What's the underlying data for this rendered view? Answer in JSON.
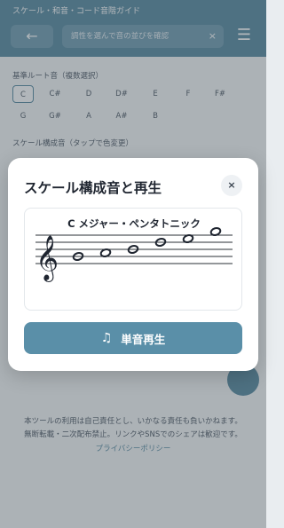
{
  "background": {
    "top_text": "スケール・和音・コード音階ガイド",
    "back_label": "←",
    "search_text": "調性を選んで音の並びを確認",
    "search_clear": "×",
    "menu_icon": "menu-icon",
    "root_label": "基準ルート音（複数選択）",
    "notes_row1": [
      "C",
      "C#",
      "D",
      "D#",
      "E",
      "F",
      "F#"
    ],
    "notes_row2": [
      "G",
      "G#",
      "A",
      "A#",
      "B"
    ],
    "scale_label": "スケール構成音（タップで色変更）",
    "footer_line1": "本ツールの利用は自己責任とし、いかなる責任も負いかねます。",
    "footer_line2": "無断転載・二次配布禁止。リンクやSNSでのシェアは歓迎です。",
    "footer_link": "プライバシーポリシー"
  },
  "modal": {
    "title": "スケール構成音と再生",
    "close_label": "×",
    "score_title": "C メジャー・ペンタトニック",
    "play_label": "単音再生",
    "play_icon": "♫",
    "clef_glyph": "𝄞"
  },
  "score": {
    "scale": "C major pentatonic",
    "notes": [
      {
        "pitch": "C5",
        "staff_step": 3
      },
      {
        "pitch": "D5",
        "staff_step": 4
      },
      {
        "pitch": "E5",
        "staff_step": 5
      },
      {
        "pitch": "G5",
        "staff_step": 7
      },
      {
        "pitch": "A5",
        "staff_step": 8
      },
      {
        "pitch": "C6",
        "staff_step": 10
      }
    ]
  },
  "colors": {
    "accent": "#5a8fa8",
    "header": "#55889f",
    "overlay": "rgba(70,80,90,0.42)"
  }
}
